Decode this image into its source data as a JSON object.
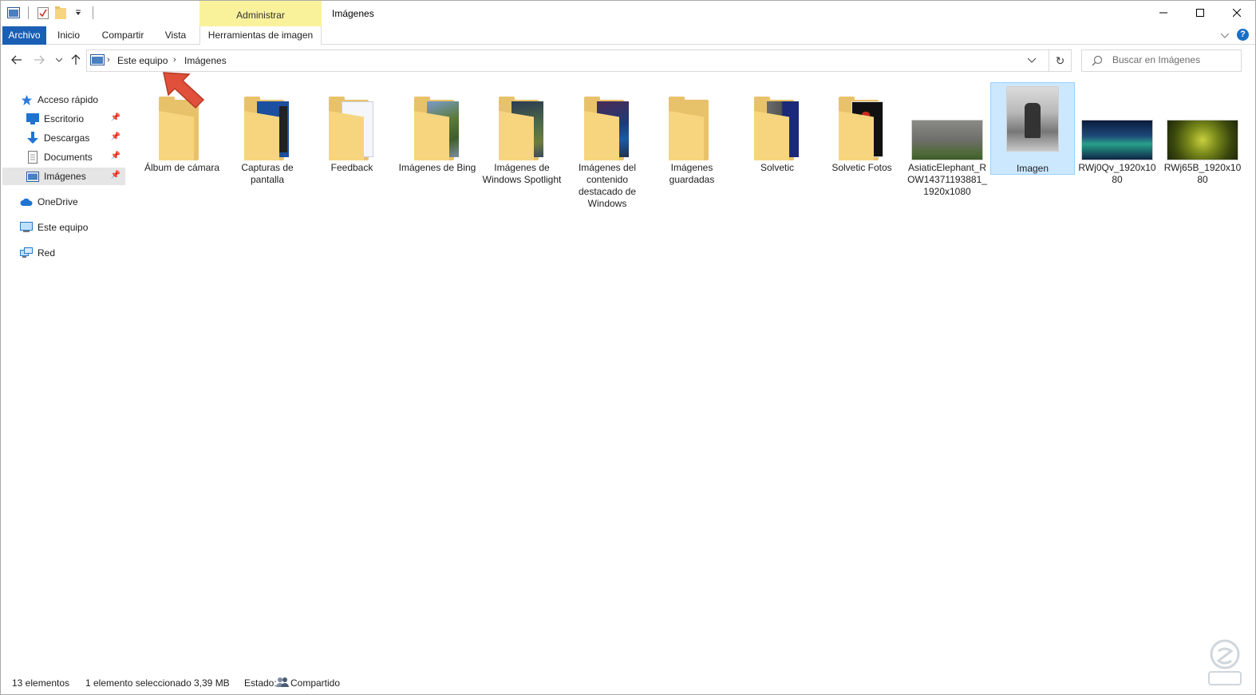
{
  "window": {
    "title": "Imágenes",
    "context_group": "Administrar"
  },
  "ribbon": {
    "tabs": [
      "Archivo",
      "Inicio",
      "Compartir",
      "Vista",
      "Herramientas de imagen"
    ]
  },
  "address": {
    "crumbs": [
      "Este equipo",
      "Imágenes"
    ]
  },
  "search": {
    "placeholder": "Buscar en Imágenes"
  },
  "sidebar": {
    "items": [
      {
        "label": "Acceso rápido",
        "icon": "star-icon"
      },
      {
        "label": "Escritorio",
        "icon": "desktop-icon",
        "pinned": true
      },
      {
        "label": "Descargas",
        "icon": "download-icon",
        "pinned": true
      },
      {
        "label": "Documents",
        "icon": "document-icon",
        "pinned": true
      },
      {
        "label": "Imágenes",
        "icon": "pictures-icon",
        "pinned": true,
        "selected": true
      },
      {
        "label": "OneDrive",
        "icon": "cloud-icon"
      },
      {
        "label": "Este equipo",
        "icon": "computer-icon"
      },
      {
        "label": "Red",
        "icon": "network-icon"
      }
    ]
  },
  "files": [
    {
      "label": "Álbum de cámara",
      "kind": "folder"
    },
    {
      "label": "Capturas de pantalla",
      "kind": "folder"
    },
    {
      "label": "Feedback",
      "kind": "folder"
    },
    {
      "label": "Imágenes de Bing",
      "kind": "folder"
    },
    {
      "label": "Imágenes de Windows Spotlight",
      "kind": "folder"
    },
    {
      "label": "Imágenes del contenido destacado de Windows",
      "kind": "folder"
    },
    {
      "label": "Imágenes guardadas",
      "kind": "folder"
    },
    {
      "label": "Solvetic",
      "kind": "folder"
    },
    {
      "label": "Solvetic Fotos",
      "kind": "folder"
    },
    {
      "label": "AsiaticElephant_ROW14371193881_1920x1080",
      "kind": "image"
    },
    {
      "label": "Imagen",
      "kind": "image",
      "selected": true
    },
    {
      "label": "RWj0Qv_1920x1080",
      "kind": "image"
    },
    {
      "label": "RWj65B_1920x1080",
      "kind": "image"
    }
  ],
  "status": {
    "count": "13 elementos",
    "selection": "1 elemento seleccionado",
    "size": "3,39 MB",
    "state_label": "Estado:",
    "state_value": "Compartido"
  },
  "colors": {
    "accent": "#1a5fb4",
    "context_tab": "#faf29b",
    "selection": "#cce8ff",
    "arrow": "#e0503a"
  }
}
